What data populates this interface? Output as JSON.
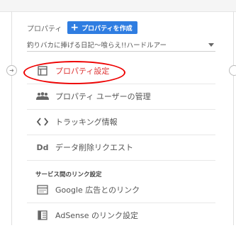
{
  "property": {
    "label": "プロパティ",
    "create_button_label": "プロパティを作成",
    "selected": "釣りバカに捧げる日記～喰らえ!!ハードルアー"
  },
  "nav": {
    "items": [
      {
        "label": "プロパティ設定",
        "icon": "property-settings-icon",
        "active": true
      },
      {
        "label": "プロパティ ユーザーの管理",
        "icon": "users-icon",
        "active": false
      },
      {
        "label": "トラッキング情報",
        "icon": "code-icon",
        "active": false
      },
      {
        "label": "データ削除リクエスト",
        "icon": "dd-icon",
        "active": false
      }
    ],
    "section_title": "サービス間のリンク設定",
    "link_items": [
      {
        "label": "Google 広告とのリンク",
        "icon": "google-ads-icon"
      },
      {
        "label": "AdSense のリンク設定",
        "icon": "adsense-icon"
      }
    ]
  },
  "dd_glyph": "Dd",
  "colors": {
    "accent": "#2f7de1",
    "highlight": "#ee0000",
    "active_text": "#dd3333"
  }
}
